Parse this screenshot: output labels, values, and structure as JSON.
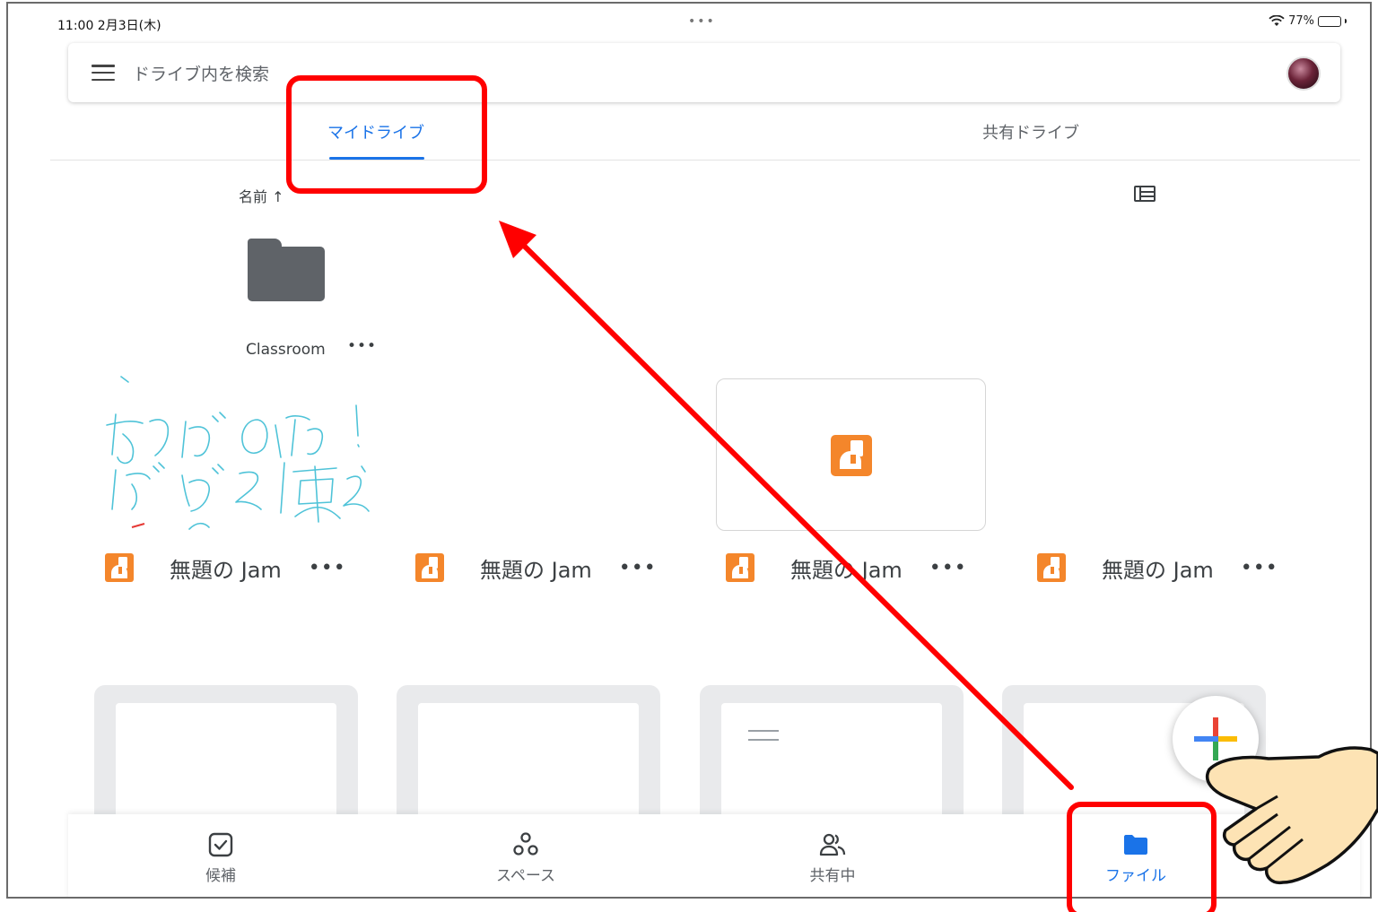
{
  "status_bar": {
    "time": "11:00  2月3日(木)",
    "dots": "•••",
    "wifi_icon": "wifi-icon",
    "battery": "77%",
    "battery_level": 0.77
  },
  "search": {
    "placeholder": "ドライブ内を検索",
    "menu_icon": "menu-icon"
  },
  "tabs": [
    {
      "label": "マイドライブ",
      "active": true
    },
    {
      "label": "共有ドライブ",
      "active": false
    }
  ],
  "sort": {
    "label": "名前 ↑",
    "view_icon": "list-view-icon"
  },
  "folder": {
    "name": "Classroom",
    "more": "•••"
  },
  "jams": [
    {
      "title": "無題の Jam",
      "more": "•••"
    },
    {
      "title": "無題の Jam",
      "more": "•••"
    },
    {
      "title": "無題の Jam",
      "more": "•••"
    },
    {
      "title": "無題の Jam",
      "more": "•••"
    }
  ],
  "fab": {
    "icon": "plus-icon"
  },
  "bottom_nav": [
    {
      "label": "候補",
      "icon": "suggested-check-icon"
    },
    {
      "label": "スペース",
      "icon": "spaces-icon"
    },
    {
      "label": "共有中",
      "icon": "shared-people-icon"
    },
    {
      "label": "ファイル",
      "icon": "folder-icon",
      "active": true
    }
  ],
  "colors": {
    "accent": "#1a73e8",
    "annotation": "#ff0000",
    "jam_orange": "#f4862b",
    "folder_gray": "#5f6368"
  }
}
